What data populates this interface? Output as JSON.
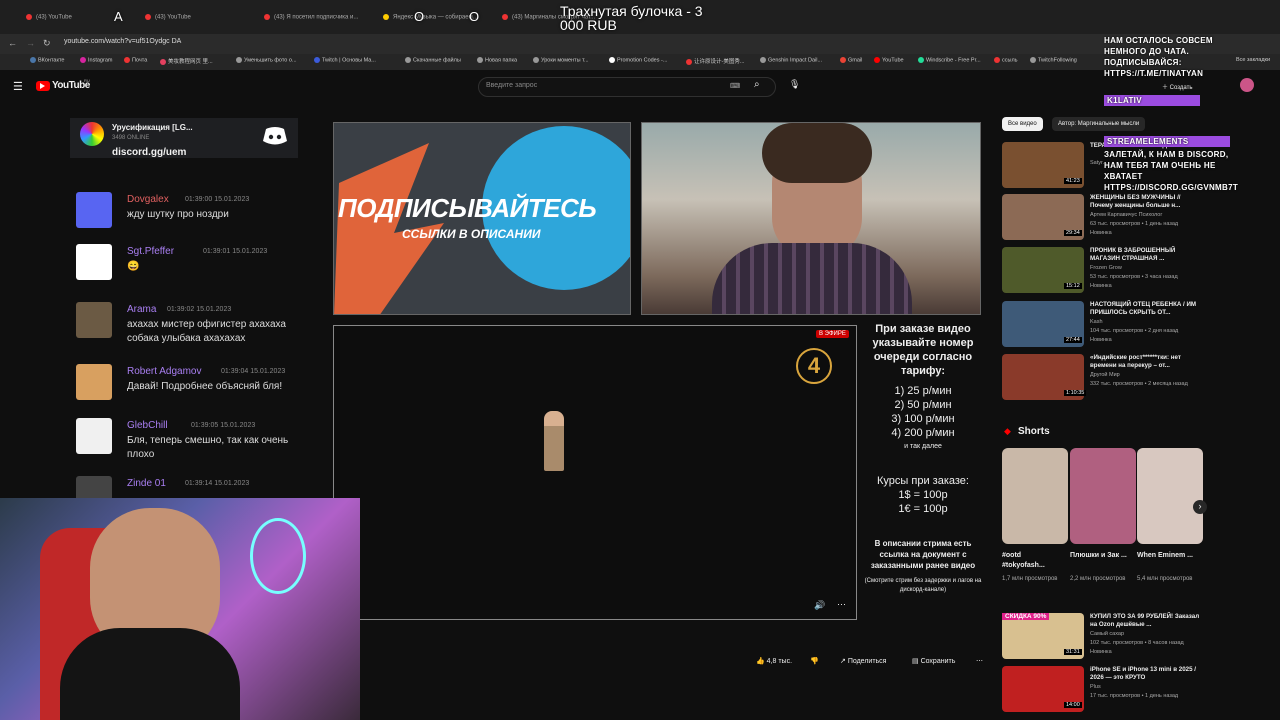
{
  "overlay": {
    "stream_title": "Трахнутая булочка - 3 000 RUB",
    "letters": [
      "A",
      "O",
      "O"
    ],
    "tw_lines": [
      "НАМ ОСТАЛОСЬ СОВСЕМ",
      "НЕМНОГО ДО ЧАТА.",
      "ПОДПИСЫВАЙСЯ:",
      "HTTPS://T.ME/TINATYAN"
    ],
    "tw_user": "K1LATIV",
    "tw_user2": "STREAMELEMENTS",
    "tw_msg2": [
      "ЗАЛЕТАЙ, К НАМ В DISCORD,",
      "НАМ ТЕБЯ ТАМ ОЧЕНЬ НЕ",
      "ХВАТАЕТ",
      "HTTPS://DISCORD.GG/GVNMB7T"
    ]
  },
  "browser": {
    "tabs": [
      "(43) YouTube",
      "(43) YouTube",
      "(43) Я посетил подписчика и...",
      "Яндекс Музыка — собираем...",
      "(43) Маргиналы смотрят чат..."
    ],
    "url": "youtube.com/watch?v=uf51Oydgc DA",
    "bookmarks": [
      "ВКонтакте",
      "Instagram",
      "Почта",
      "美妆教程网页 里...",
      "Уменьшить фото о...",
      "Twitch | Основы Ма...",
      "Скачанные файлы",
      "Новая папка",
      "Уроки моменты т...",
      "Promotion Codes -...",
      "让许原设计-美图秀...",
      "Genshin Impact Dail...",
      "Gmail",
      "YouTube",
      "Windscribe - Free Pr...",
      "ссыль",
      "TwitchFollowing",
      "Все закладки"
    ]
  },
  "youtube": {
    "logo": "YouTube",
    "logo_sup": "RU",
    "search_placeholder": "Введите запрос",
    "create_label": "Создать"
  },
  "discord": {
    "server": "Урусификация [LG...",
    "online": "3498 ONLINE",
    "invite": "discord.gg/uem"
  },
  "chat": [
    {
      "name": "Dovgalex",
      "time": "01:39:00 15.01.2023",
      "text": "жду шутку про ноздри",
      "color": "#e06060",
      "avbg": "#5865f2"
    },
    {
      "name": "Sgt.Pfeffer",
      "time": "01:39:01 15.01.2023",
      "text": "😄",
      "color": "#a97ff2",
      "avbg": "#ffffff"
    },
    {
      "name": "Arama",
      "time": "01:39:02 15.01.2023",
      "text": "ахахах мистер офигистер ахахаха собака улыбака ахахахах",
      "color": "#a97ff2",
      "avbg": "#6b5a44"
    },
    {
      "name": "Robert Adgamov",
      "time": "01:39:04 15.01.2023",
      "text": "Давай! Подробнее объясняй бля!",
      "color": "#a97ff2",
      "avbg": "#d8a060"
    },
    {
      "name": "GlebChill",
      "time": "01:39:05 15.01.2023",
      "text": "Бля, теперь смешно, так как очень плохо",
      "color": "#a97ff2",
      "avbg": "#f0f0f0"
    },
    {
      "name": "Zinde 01",
      "time": "01:39:14 15.01.2023",
      "text": "",
      "color": "#a97ff2",
      "avbg": "#444"
    }
  ],
  "video": {
    "promo_line1": "ПОДПИСЫВАЙТЕСЬ",
    "promo_line2": "ССЫЛКИ В ОПИСАНИИ",
    "live_badge": "В ЭФИРЕ",
    "info": {
      "order_title": "При заказе видео указывайте номер очереди согласно тарифу:",
      "tariffs": [
        "1) 25 р/мин",
        "2) 50 р/мин",
        "3) 100 р/мин",
        "4) 200 р/мин"
      ],
      "etc": "и так далее",
      "rates_title": "Курсы при заказе:",
      "rates": [
        "1$ = 100р",
        "1€ = 100р"
      ],
      "desc": "В описании стрима есть ссылка на документ с заказанными ранее видео",
      "note": "(Смотрите стрим без задержки и лагов на дискорд-канале)"
    }
  },
  "actions": {
    "likes": "4,8 тыс.",
    "share": "Поделиться",
    "save": "Сохранить"
  },
  "sidebar": {
    "chips": [
      "Все видео",
      "Автор: Маргинальные мысли"
    ],
    "recs": [
      {
        "title": "ТЕРАПИЯ... СВЯТОЙ ОРДЕН",
        "meta": [
          "Satyr...",
          ""
        ],
        "dur": "41:23",
        "bg": "#7a5030"
      },
      {
        "title": "ЖЕНЩИНЫ БЕЗ МУЖЧИНЫ // Почему женщины больше н...",
        "meta": [
          "Артем Карпавичус Психолог",
          "63 тыс. просмотров • 1 день назад",
          "Новинка"
        ],
        "dur": "29:34",
        "bg": "#8c6a55"
      },
      {
        "title": "ПРОНИК В ЗАБРОШЕННЫЙ МАГАЗИН СТРАШНАЯ ...",
        "meta": [
          "Frozen Grow",
          "53 тыс. просмотров • 3 часа назад",
          "Новинка"
        ],
        "dur": "15:12",
        "bg": "#4f5a2a"
      },
      {
        "title": "НАСТОЯЩИЙ ОТЕЦ РЕБЕНКА / ИМ ПРИШЛОСЬ СКРЫТЬ ОТ...",
        "meta": [
          "Kash",
          "104 тыс. просмотров • 2 дня назад",
          "Новинка"
        ],
        "dur": "27:44",
        "bg": "#3e5a78"
      },
      {
        "title": "«Индийские рост******тки: нет времени на перекур – от...",
        "meta": [
          "Другой Мир",
          "332 тыс. просмотров • 2 месяца назад"
        ],
        "dur": "1:10:35",
        "bg": "#8a3a2a"
      }
    ],
    "shorts_label": "Shorts",
    "shorts": [
      {
        "title": "#ootd #tokyofash...",
        "meta": "1,7 млн просмотров",
        "bg": "#c9b8a8"
      },
      {
        "title": "Плюшки и Зак ...",
        "meta": "2,2 млн просмотров",
        "bg": "#b06080"
      },
      {
        "title": "When Eminem ...",
        "meta": "5,4 млн просмотров",
        "bg": "#d8c8c0"
      }
    ],
    "bottom_recs": [
      {
        "title": "КУПИЛ ЭТО ЗА 99 РУБЛЕЙ! Заказал на Ozon дешёвые ...",
        "meta": [
          "Самый сахар",
          "102 тыс. просмотров • 8 часов назад",
          "Новинка"
        ],
        "dur": "31:31",
        "badge": "СКИДКА 90%",
        "bg": "#d8c090"
      },
      {
        "title": "iPhone SE и iPhone 13 mini в 2025 / 2026 — это КРУТО",
        "meta": [
          "Plus",
          "17 тыс. просмотров • 1 день назад"
        ],
        "dur": "14:00",
        "bg": "#c02020"
      }
    ]
  }
}
